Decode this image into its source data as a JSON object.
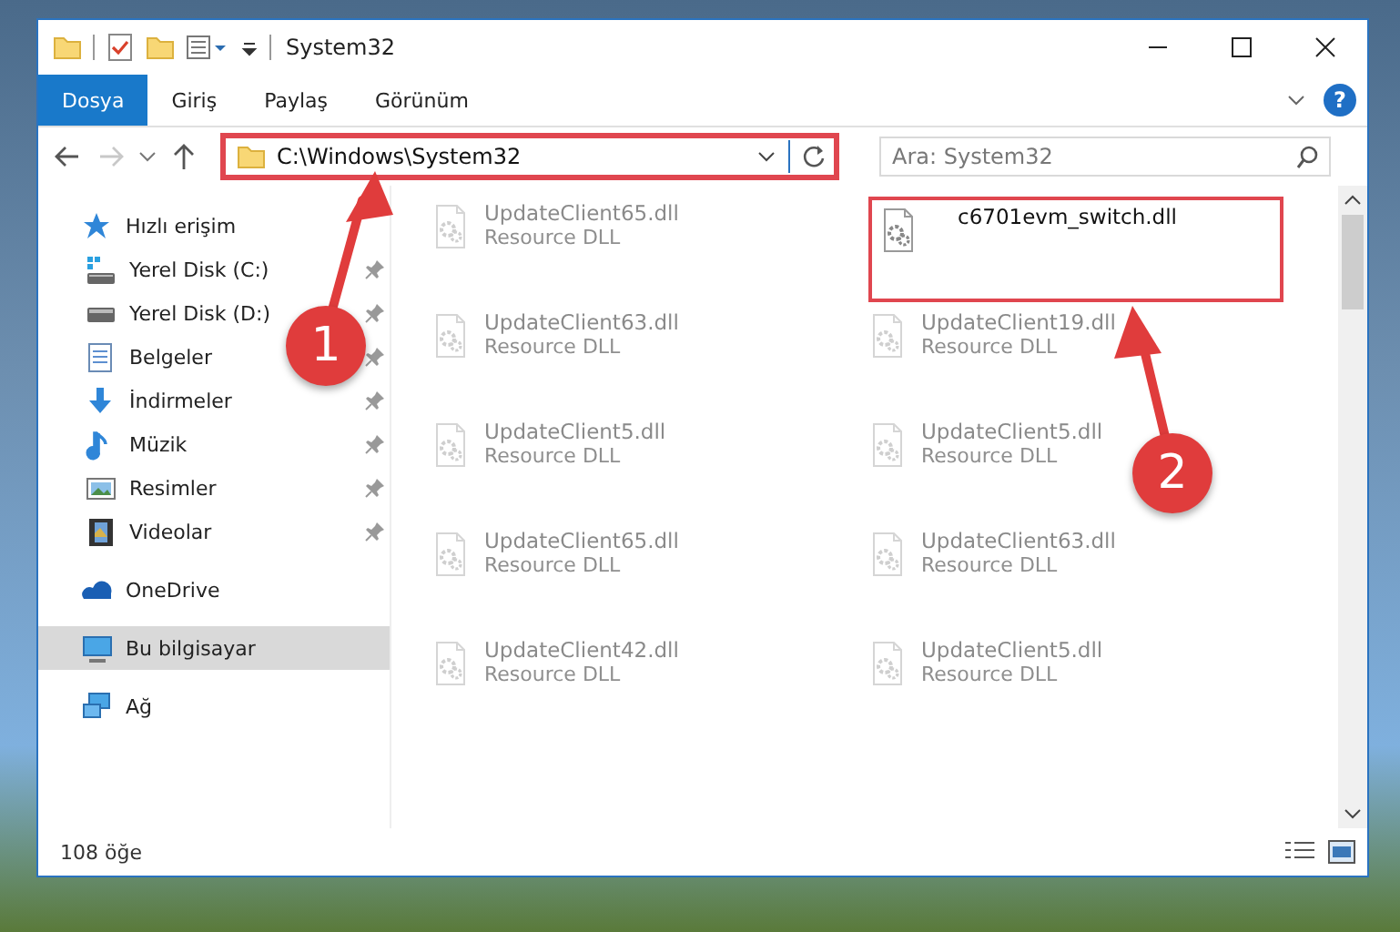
{
  "window": {
    "title": "System32"
  },
  "ribbon_tabs": [
    {
      "label": "Dosya",
      "selected": true
    },
    {
      "label": "Giriş",
      "selected": false
    },
    {
      "label": "Paylaş",
      "selected": false
    },
    {
      "label": "Görünüm",
      "selected": false
    }
  ],
  "help_button": {
    "label": "?"
  },
  "address_bar": {
    "path": "C:\\Windows\\System32",
    "highlighted": true
  },
  "search": {
    "placeholder": "Ara: System32"
  },
  "sidebar": {
    "items": [
      {
        "label": "Hızlı erişim",
        "kind": "star",
        "selected": false,
        "children": [
          {
            "label": "Yerel Disk (C:)",
            "kind": "system-drive",
            "pinned": true,
            "selected": false
          },
          {
            "label": "Yerel Disk (D:)",
            "kind": "drive",
            "pinned": true,
            "selected": false
          },
          {
            "label": "Belgeler",
            "kind": "document",
            "pinned": true,
            "selected": false
          },
          {
            "label": "İndirmeler",
            "kind": "download",
            "pinned": true,
            "selected": false
          },
          {
            "label": "Müzik",
            "kind": "music",
            "pinned": true,
            "selected": false
          },
          {
            "label": "Resimler",
            "kind": "picture",
            "pinned": true,
            "selected": false
          },
          {
            "label": "Videolar",
            "kind": "video",
            "pinned": true,
            "selected": false
          }
        ]
      },
      {
        "label": "OneDrive",
        "kind": "cloud",
        "selected": false
      },
      {
        "label": "Bu bilgisayar",
        "kind": "computer",
        "selected": true
      },
      {
        "label": "Ağ",
        "kind": "network",
        "selected": false
      }
    ]
  },
  "files": [
    {
      "name": "UpdateClient65.dll",
      "type": "Resource DLL",
      "faded": true,
      "highlighted": false
    },
    {
      "name": "c6701evm_switch.dll",
      "faded": false,
      "highlighted": true
    },
    {
      "name": "UpdateClient63.dll",
      "type": "Resource DLL",
      "faded": true,
      "highlighted": false
    },
    {
      "name": "UpdateClient19.dll",
      "type": "Resource DLL",
      "faded": true,
      "highlighted": false
    },
    {
      "name": "UpdateClient5.dll",
      "type": "Resource DLL",
      "faded": true,
      "highlighted": false
    },
    {
      "name": "UpdateClient5.dll",
      "type": "Resource DLL",
      "faded": true,
      "highlighted": false
    },
    {
      "name": "UpdateClient65.dll",
      "type": "Resource DLL",
      "faded": true,
      "highlighted": false
    },
    {
      "name": "UpdateClient63.dll",
      "type": "Resource DLL",
      "faded": true,
      "highlighted": false
    },
    {
      "name": "UpdateClient42.dll",
      "type": "Resource DLL",
      "faded": true,
      "highlighted": false
    },
    {
      "name": "UpdateClient5.dll",
      "type": "Resource DLL",
      "faded": true,
      "highlighted": false
    }
  ],
  "status_bar": {
    "item_count": "108 öğe"
  },
  "step_markers": [
    {
      "label": "1"
    },
    {
      "label": "2"
    }
  ]
}
